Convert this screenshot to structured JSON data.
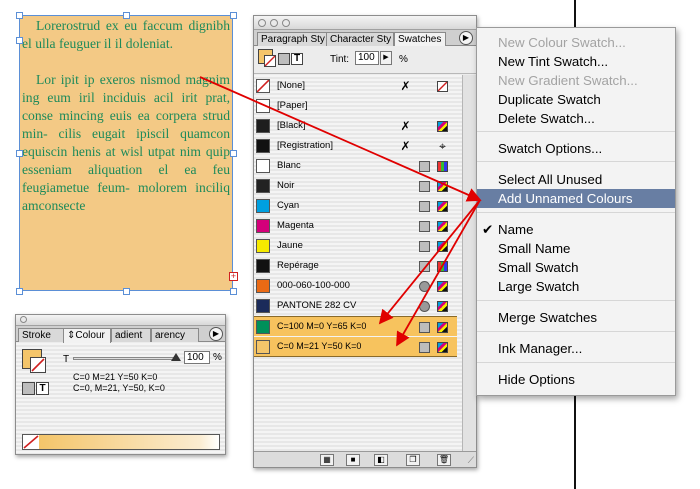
{
  "text_frame": {
    "paragraphs": [
      "Lorerostrud ex eu faccum dignibh el ulla feuguer il il doleniat.",
      "Lor ipit ip exeros nismod magnim ing eum iril inciduis acil irit prat, conse mincing euis ea corpera strud min- cilis eugait ipiscil quamcon equiscin henis at wisl utpat nim quip esseniam aliquation el ea feu feugiametue feum- molorem inciliq amconsecte"
    ],
    "overset_mark": "+",
    "text_color": "#1d8a5a",
    "fill_color": "#f3c985"
  },
  "swatches_panel": {
    "tabs": [
      "Paragraph Sty",
      "Character Sty",
      "Swatches"
    ],
    "active_tab": "Swatches",
    "text_mode_label": "T",
    "tint_label": "Tint:",
    "tint_value": "100",
    "tint_unit": "%",
    "swatches": [
      {
        "name": "[None]",
        "color": "#ffffff"
      },
      {
        "name": "[Paper]",
        "color": "#ffffff"
      },
      {
        "name": "[Black]",
        "color": "#1e1e1e"
      },
      {
        "name": "[Registration]",
        "color": "#111111"
      },
      {
        "name": "Blanc",
        "color": "#ffffff"
      },
      {
        "name": "Noir",
        "color": "#222222"
      },
      {
        "name": "Cyan",
        "color": "#00a0e0"
      },
      {
        "name": "Magenta",
        "color": "#d4007a"
      },
      {
        "name": "Jaune",
        "color": "#f5ea00"
      },
      {
        "name": "Repérage",
        "color": "#111111"
      },
      {
        "name": "000-060-100-000",
        "color": "#ea6a14"
      },
      {
        "name": "PANTONE 282 CV",
        "color": "#1b2b5a"
      },
      {
        "name": "C=100 M=0 Y=65 K=0",
        "color": "#00905a"
      },
      {
        "name": "C=0 M=21 Y=50 K=0",
        "color": "#f4c56a"
      }
    ]
  },
  "colour_panel": {
    "tabs": [
      "Stroke",
      "Colour",
      "adient",
      "arency"
    ],
    "active_tab": "Colour",
    "tint_label": "T",
    "tint_value": "100",
    "tint_unit": "%",
    "text_mode_label": "T",
    "values_line1": "C=0 M=21 Y=50 K=0",
    "values_line2": "C=0, M=21, Y=50, K=0",
    "fill_color": "#f4c56a"
  },
  "context_menu": {
    "items": [
      {
        "label": "New Colour Swatch...",
        "disabled": true
      },
      {
        "label": "New Tint Swatch...",
        "disabled": false
      },
      {
        "label": "New Gradient Swatch...",
        "disabled": true
      },
      {
        "label": "Duplicate Swatch",
        "disabled": false
      },
      {
        "label": "Delete Swatch...",
        "disabled": false
      },
      {
        "label": "Swatch Options...",
        "disabled": false
      },
      {
        "label": "Select All Unused",
        "disabled": false
      },
      {
        "label": "Add Unnamed Colours",
        "disabled": false,
        "selected": true
      },
      {
        "label": "Name",
        "disabled": false,
        "checked": true
      },
      {
        "label": "Small Name",
        "disabled": false
      },
      {
        "label": "Small Swatch",
        "disabled": false
      },
      {
        "label": "Large Swatch",
        "disabled": false
      },
      {
        "label": "Merge Swatches",
        "disabled": false
      },
      {
        "label": "Ink Manager...",
        "disabled": false
      },
      {
        "label": "Hide Options",
        "disabled": false
      }
    ],
    "check_mark": "✔",
    "highlight_color": "#687ea3"
  },
  "annotation_color": "#e00000"
}
